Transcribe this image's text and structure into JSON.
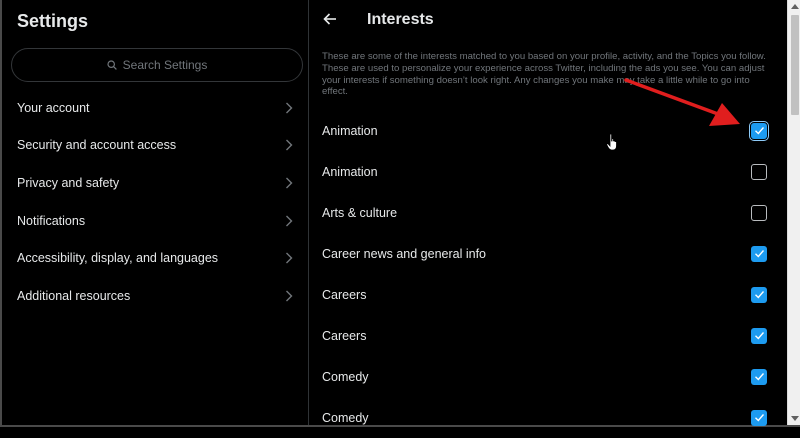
{
  "left": {
    "title": "Settings",
    "search_placeholder": "Search Settings",
    "menu": [
      {
        "label": "Your account"
      },
      {
        "label": "Security and account access"
      },
      {
        "label": "Privacy and safety"
      },
      {
        "label": "Notifications"
      },
      {
        "label": "Accessibility, display, and languages"
      },
      {
        "label": "Additional resources"
      }
    ]
  },
  "right": {
    "title": "Interests",
    "description": "These are some of the interests matched to you based on your profile, activity, and the Topics you follow. These are used to personalize your experience across Twitter, including the ads you see. You can adjust your interests if something doesn’t look right. Any changes you make may take a little while to go into effect.",
    "interests": [
      {
        "label": "Animation",
        "checked": true
      },
      {
        "label": "Animation",
        "checked": false
      },
      {
        "label": "Arts & culture",
        "checked": false
      },
      {
        "label": "Career news and general info",
        "checked": true
      },
      {
        "label": "Careers",
        "checked": true
      },
      {
        "label": "Careers",
        "checked": true
      },
      {
        "label": "Comedy",
        "checked": true
      },
      {
        "label": "Comedy",
        "checked": true
      }
    ]
  },
  "colors": {
    "accent": "#1d9bf0",
    "annotation_arrow": "#e01e1e",
    "background": "#000000",
    "muted_text": "#71767b"
  },
  "icons": {
    "back": "arrow-left-icon",
    "search": "magnifier-icon",
    "chevron": "chevron-right-icon",
    "check": "checkmark-icon"
  }
}
